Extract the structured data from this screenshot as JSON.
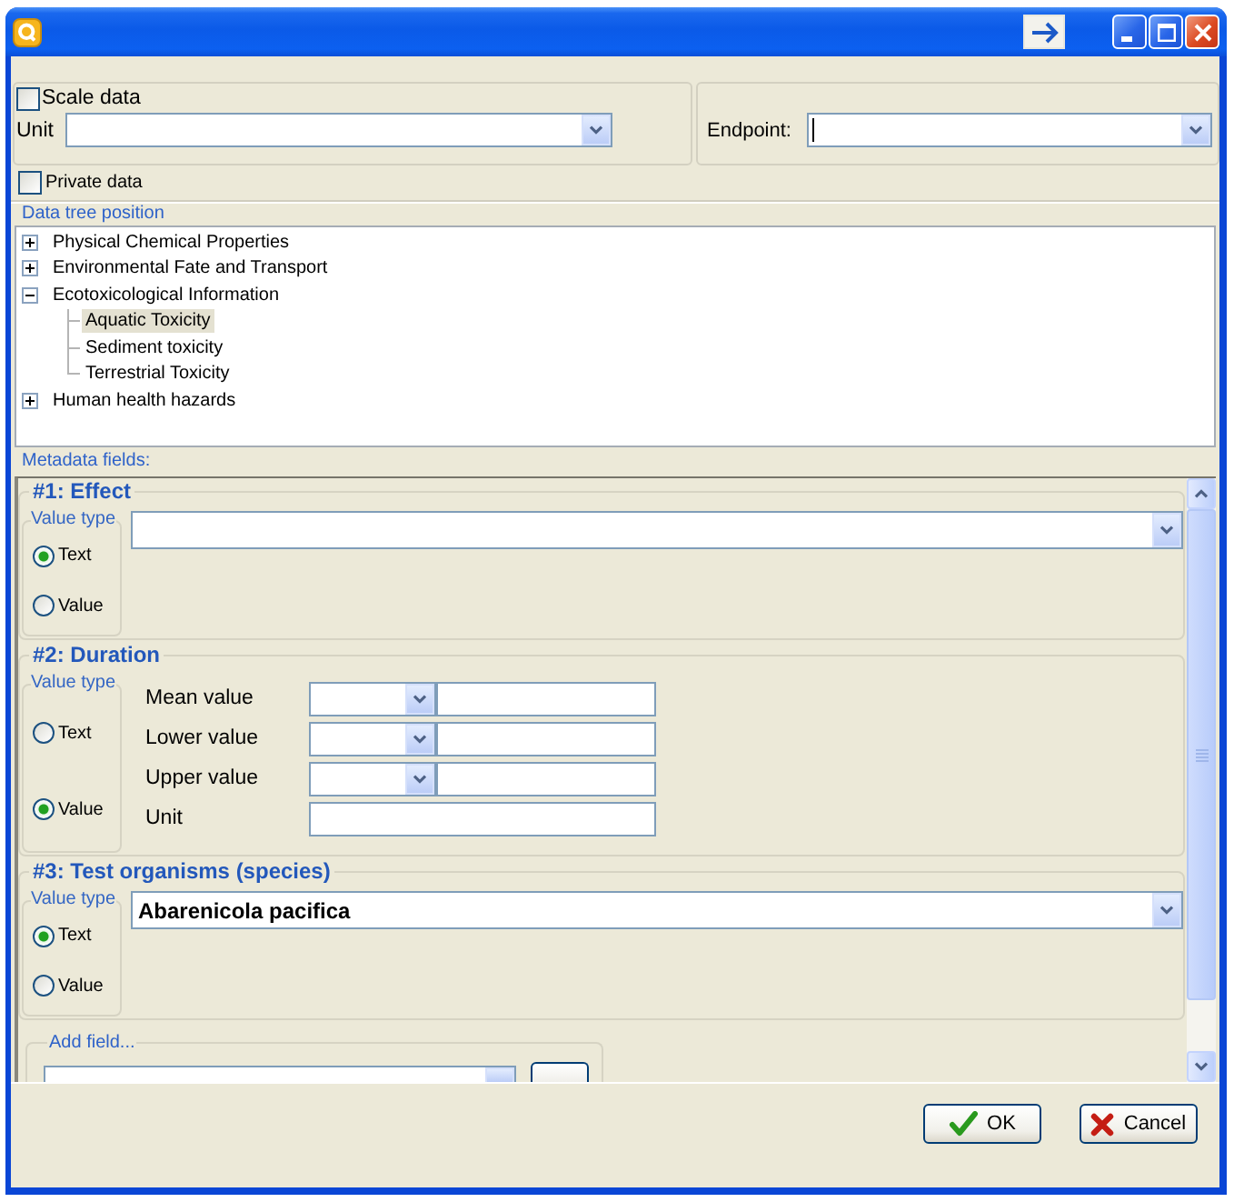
{
  "scale_data": {
    "label": "Scale data",
    "checked": false
  },
  "unit": {
    "label": "Unit"
  },
  "endpoint": {
    "label": "Endpoint:",
    "focused": true
  },
  "private_data": {
    "label": "Private data",
    "checked": false
  },
  "data_tree": {
    "label": "Data tree position",
    "items": [
      {
        "label": "Physical Chemical Properties",
        "expanded": false,
        "selected": false
      },
      {
        "label": "Environmental Fate and Transport",
        "expanded": false,
        "selected": false
      },
      {
        "label": "Ecotoxicological Information",
        "expanded": true,
        "selected": false,
        "children": [
          {
            "label": "Aquatic Toxicity",
            "selected": true
          },
          {
            "label": "Sediment toxicity",
            "selected": false
          },
          {
            "label": "Terrestrial Toxicity",
            "selected": false
          }
        ]
      },
      {
        "label": "Human health hazards",
        "expanded": false,
        "selected": false
      }
    ]
  },
  "metadata": {
    "label": "Metadata fields:",
    "fields": [
      {
        "title": "#1: Effect",
        "kind": "choice",
        "value_type": {
          "label": "Value type",
          "options": [
            {
              "label": "Text",
              "selected": true
            },
            {
              "label": "Value",
              "selected": false
            }
          ]
        }
      },
      {
        "title": "#2: Duration",
        "kind": "range",
        "value_type": {
          "label": "Value type",
          "options": [
            {
              "label": "Text",
              "selected": false
            },
            {
              "label": "Value",
              "selected": true
            }
          ]
        },
        "rows": [
          {
            "label": "Mean value",
            "kind": "qualified"
          },
          {
            "label": "Lower value",
            "kind": "qualified"
          },
          {
            "label": "Upper value",
            "kind": "qualified"
          },
          {
            "label": "Unit",
            "kind": "plain"
          }
        ]
      },
      {
        "title": "#3: Test organisms (species)",
        "kind": "choice",
        "value": "Abarenicola pacifica",
        "value_type": {
          "label": "Value type",
          "options": [
            {
              "label": "Text",
              "selected": true
            },
            {
              "label": "Value",
              "selected": false
            }
          ]
        }
      }
    ],
    "add_field": {
      "label": "Add field..."
    }
  },
  "buttons": [
    {
      "label": "OK",
      "kind": "ok"
    },
    {
      "label": "Cancel",
      "kind": "cancel"
    }
  ]
}
